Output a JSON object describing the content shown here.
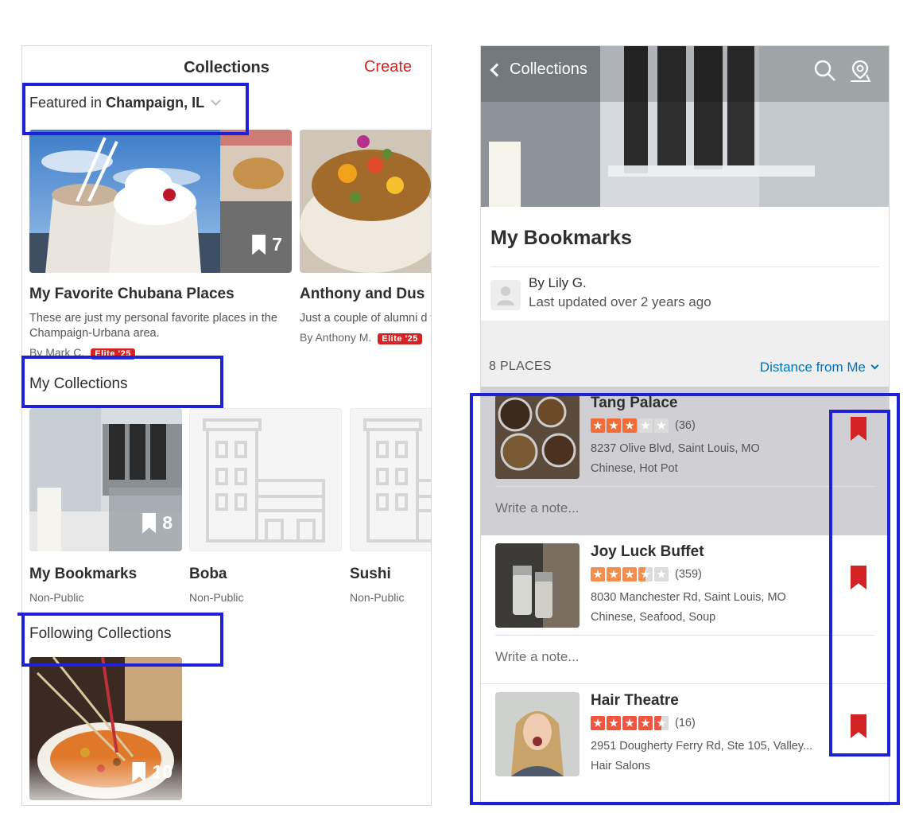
{
  "left": {
    "header": {
      "title": "Collections",
      "create_label": "Create"
    },
    "featured": {
      "prefix": "Featured in",
      "location": "Champaign, IL"
    },
    "featured_cards": [
      {
        "title": "My Favorite Chubana Places",
        "description": "These are just my personal favorite places in the Champaign-Urbana area.",
        "author": "By Mark C.",
        "badge": "Elite '25",
        "count": "7"
      },
      {
        "title": "Anthony and Dus",
        "description": "Just a couple of alumni d fans for some reason. W",
        "author": "By Anthony M.",
        "badge": "Elite '25"
      }
    ],
    "my_collections": {
      "heading": "My Collections",
      "items": [
        {
          "title": "My Bookmarks",
          "sub": "Non-Public",
          "count": "8"
        },
        {
          "title": "Boba",
          "sub": "Non-Public"
        },
        {
          "title": "Sushi",
          "sub": "Non-Public"
        }
      ]
    },
    "following": {
      "heading": "Following Collections",
      "count": "10"
    }
  },
  "right": {
    "back_label": "Collections",
    "title": "My Bookmarks",
    "owner": "By Lily G.",
    "updated": "Last updated over 2 years ago",
    "places_count": "8 PLACES",
    "sort_label": "Distance from Me",
    "places": [
      {
        "name": "Tang Palace",
        "rating": 3,
        "reviews": "(36)",
        "address": "8237 Olive Blvd, Saint Louis, MO",
        "categories": "Chinese, Hot Pot",
        "note_placeholder": "Write a note..."
      },
      {
        "name": "Joy Luck Buffet",
        "rating": 3.5,
        "reviews": "(359)",
        "address": "8030 Manchester Rd, Saint Louis, MO",
        "categories": "Chinese, Seafood, Soup",
        "note_placeholder": "Write a note..."
      },
      {
        "name": "Hair Theatre",
        "rating": 4.5,
        "reviews": "(16)",
        "address": "2951 Dougherty Ferry Rd, Ste 105, Valley...",
        "categories": "Hair Salons"
      }
    ]
  },
  "colors": {
    "brand_red": "#d32323",
    "link_blue": "#0073bb",
    "annotation_blue": "#1e22d4"
  }
}
